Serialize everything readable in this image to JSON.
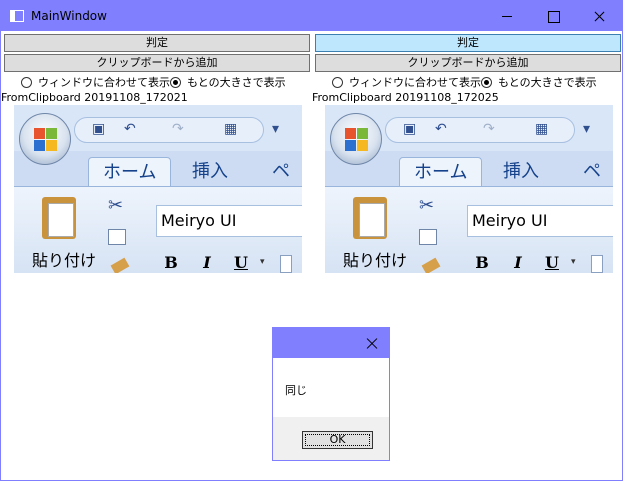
{
  "window": {
    "title": "MainWindow",
    "accent_color": "#8080ff"
  },
  "left_panel": {
    "judge_label": "判定",
    "add_from_clipboard_label": "クリップボードから追加",
    "radio_fit": "ウィンドウに合わせて表示",
    "radio_original": "もとの大きさで表示",
    "selected_radio": "original",
    "capture_label": "FromClipboard 20191108_172021"
  },
  "right_panel": {
    "judge_label": "判定",
    "add_from_clipboard_label": "クリップボードから追加",
    "radio_fit": "ウィンドウに合わせて表示",
    "radio_original": "もとの大きさで表示",
    "selected_radio": "original",
    "capture_label": "FromClipboard 20191108_172025"
  },
  "office_capture": {
    "tab_home": "ホーム",
    "tab_insert": "挿入",
    "tab_page": "ペー",
    "paste_label": "貼り付け",
    "font_name": "Meiryo UI",
    "bold": "B",
    "italic": "I",
    "underline": "U"
  },
  "message_box": {
    "message": "同じ",
    "ok_label": "OK"
  }
}
